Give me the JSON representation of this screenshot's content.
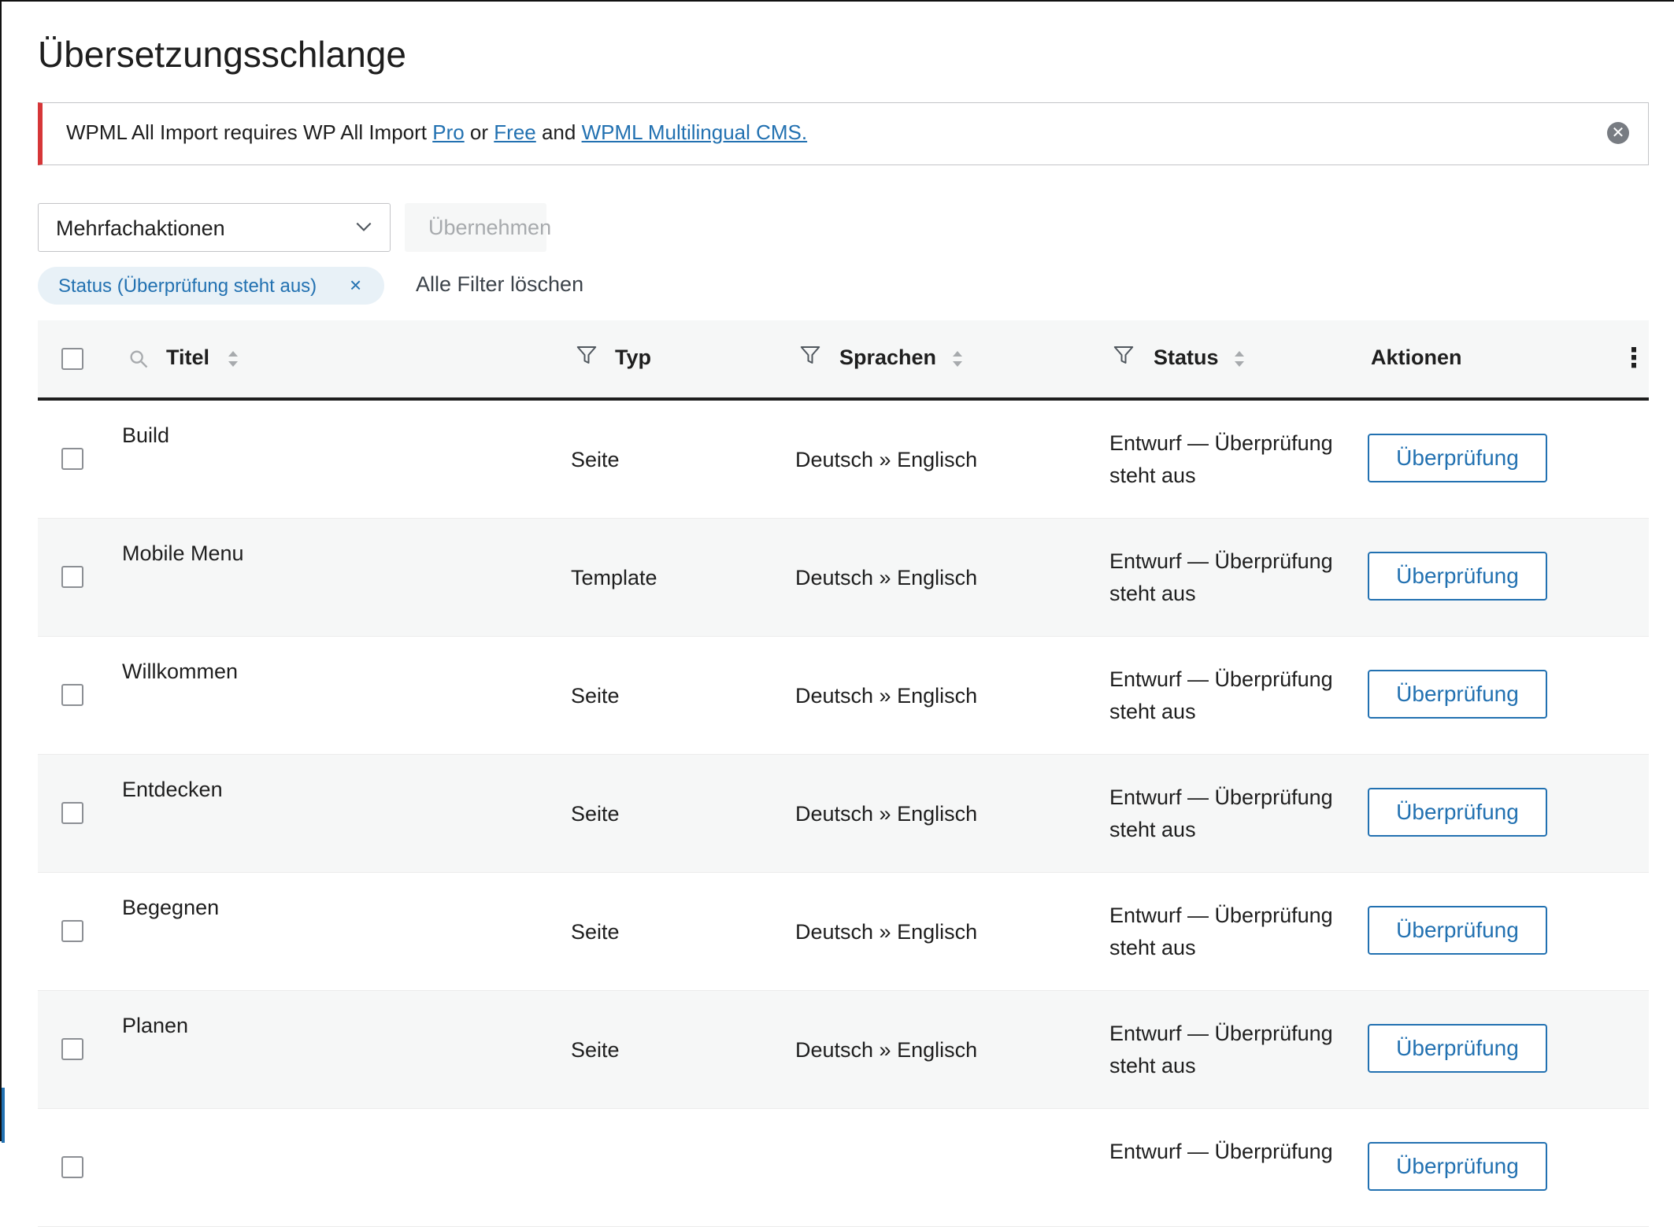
{
  "page_title": "Übersetzungsschlange",
  "notice": {
    "text_before": "WPML All Import requires WP All Import ",
    "link_pro": "Pro",
    "text_or": " or ",
    "link_free": "Free",
    "text_and": " and ",
    "link_wpml": "WPML Multilingual CMS.",
    "close_glyph": "✕"
  },
  "toolbar": {
    "bulk_actions_label": "Mehrfachaktionen",
    "apply_label": "Übernehmen"
  },
  "filters": {
    "active_chip_label": "Status (Überprüfung steht aus)",
    "chip_close_glyph": "×",
    "clear_all_label": "Alle Filter löschen"
  },
  "table": {
    "columns": {
      "title": "Titel",
      "type": "Typ",
      "languages": "Sprachen",
      "status": "Status",
      "actions": "Aktionen"
    },
    "more_glyph": "⋮",
    "rows": [
      {
        "title": "Build",
        "type": "Seite",
        "languages": "Deutsch » Englisch",
        "status_line1": "Entwurf — Überprüfung",
        "status_line2": "steht aus",
        "action": "Überprüfung"
      },
      {
        "title": "Mobile Menu",
        "type": "Template",
        "languages": "Deutsch » Englisch",
        "status_line1": "Entwurf — Überprüfung",
        "status_line2": "steht aus",
        "action": "Überprüfung"
      },
      {
        "title": "Willkommen",
        "type": "Seite",
        "languages": "Deutsch » Englisch",
        "status_line1": "Entwurf — Überprüfung",
        "status_line2": "steht aus",
        "action": "Überprüfung"
      },
      {
        "title": "Entdecken",
        "type": "Seite",
        "languages": "Deutsch » Englisch",
        "status_line1": "Entwurf — Überprüfung",
        "status_line2": "steht aus",
        "action": "Überprüfung"
      },
      {
        "title": "Begegnen",
        "type": "Seite",
        "languages": "Deutsch » Englisch",
        "status_line1": "Entwurf — Überprüfung",
        "status_line2": "steht aus",
        "action": "Überprüfung"
      },
      {
        "title": "Planen",
        "type": "Seite",
        "languages": "Deutsch » Englisch",
        "status_line1": "Entwurf — Überprüfung",
        "status_line2": "steht aus",
        "action": "Überprüfung"
      },
      {
        "title": "",
        "type": "",
        "languages": "",
        "status_line1": "Entwurf — Überprüfung",
        "status_line2": "",
        "action": "Überprüfung"
      }
    ]
  },
  "colors": {
    "accent": "#2271b1",
    "notice_error": "#d63638",
    "header_bg": "#f6f7f7"
  }
}
